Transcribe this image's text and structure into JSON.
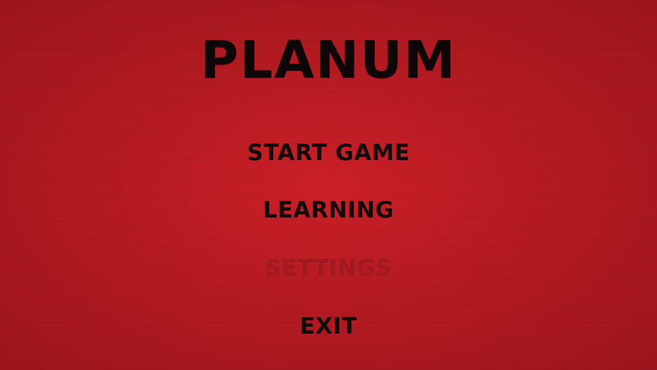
{
  "game": {
    "title": "PLANUM"
  },
  "menu": {
    "items": [
      {
        "label": "START GAME",
        "state": "enabled"
      },
      {
        "label": "LEARNING",
        "state": "enabled"
      },
      {
        "label": "SETTINGS",
        "state": "disabled"
      },
      {
        "label": "EXIT",
        "state": "enabled"
      }
    ]
  },
  "colors": {
    "background_center": "#cf2027",
    "background_edge": "#9e151c",
    "text": "#150a0b",
    "disabled_text": "#a11a20"
  }
}
